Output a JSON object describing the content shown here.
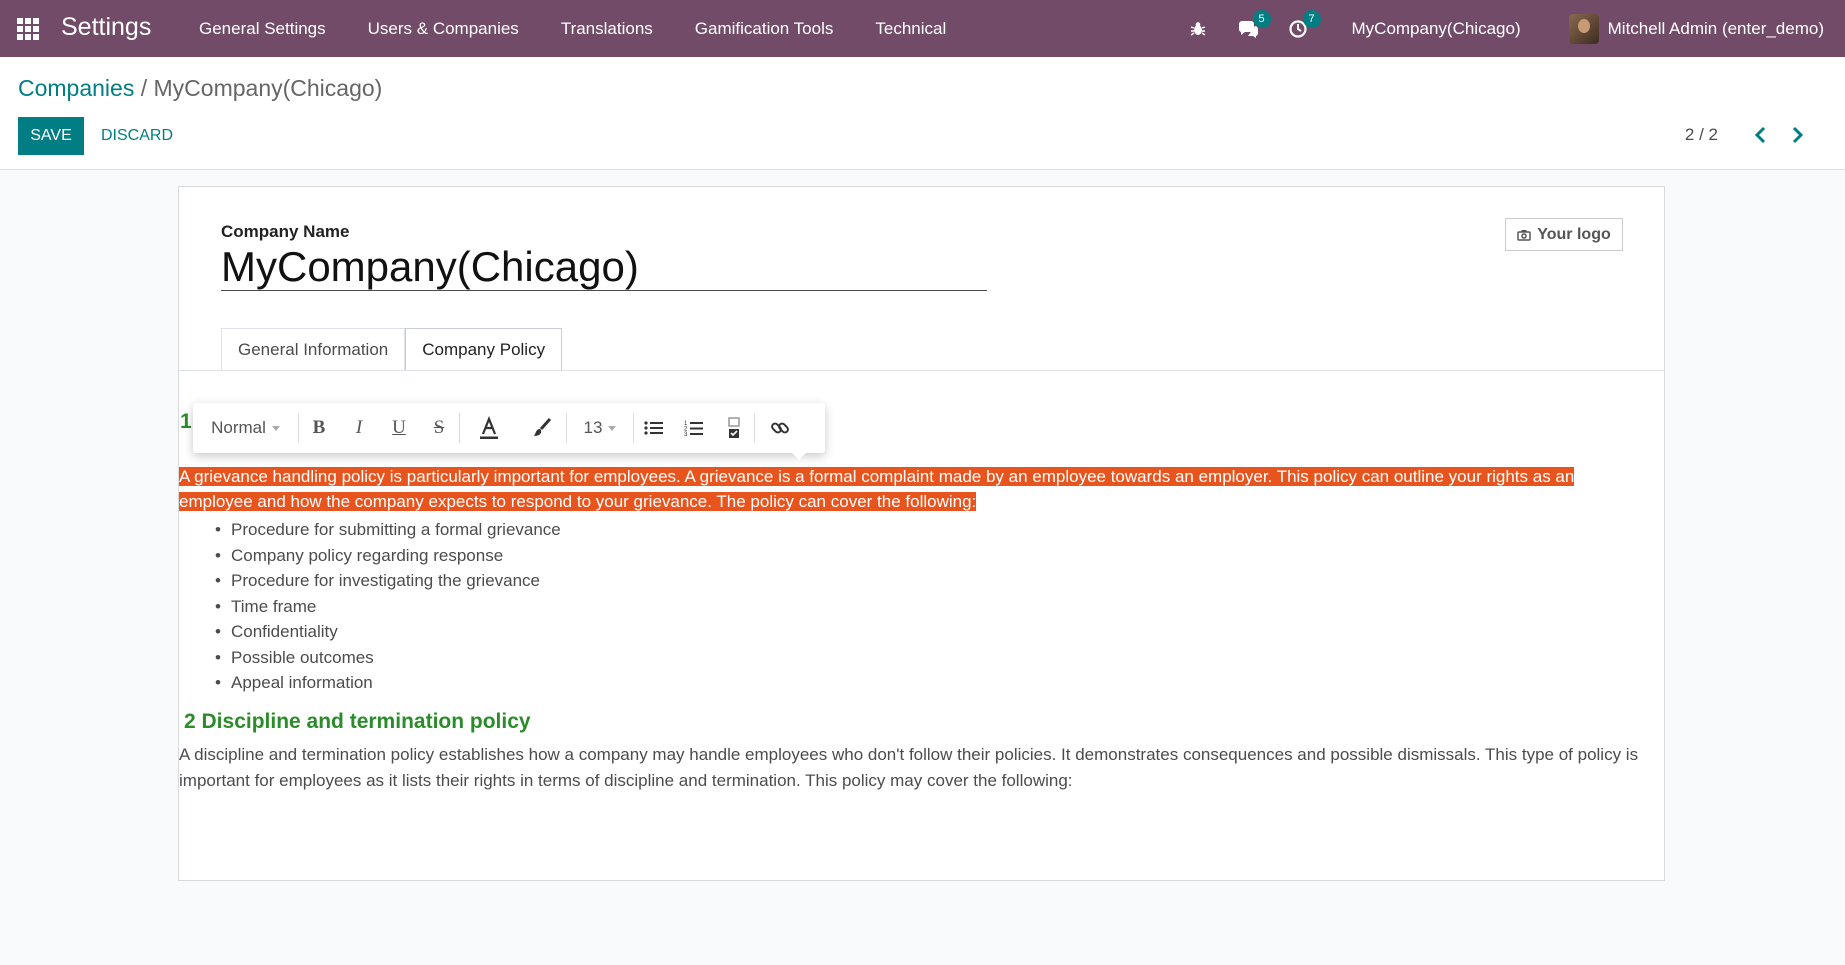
{
  "navbar": {
    "app_title": "Settings",
    "menu": [
      "General Settings",
      "Users & Companies",
      "Translations",
      "Gamification Tools",
      "Technical"
    ],
    "messages_badge": "5",
    "activities_badge": "7",
    "company": "MyCompany(Chicago)",
    "user": "Mitchell Admin (enter_demo)"
  },
  "breadcrumb": {
    "parent": "Companies",
    "separator": "/",
    "current": "MyCompany(Chicago)"
  },
  "actions": {
    "save": "SAVE",
    "discard": "DISCARD"
  },
  "pager": {
    "value": "2 / 2"
  },
  "form": {
    "name_label": "Company Name",
    "name_value": "MyCompany(Chicago)",
    "logo_button": "Your logo",
    "tabs": [
      "General Information",
      "Company Policy"
    ],
    "active_tab": "Company Policy"
  },
  "toolbar": {
    "style": "Normal",
    "font_size": "13"
  },
  "policy": {
    "heading1_number": "1",
    "grievance_paragraph": "A grievance handling policy is particularly important for employees. A grievance is a formal complaint made by an employee towards an employer. This policy can outline your rights as an employee and how the company expects to respond to your grievance. The policy can cover the following:",
    "grievance_items": [
      "Procedure for submitting a formal grievance",
      "Company policy regarding response",
      "Procedure for investigating the grievance",
      "Time frame",
      "Confidentiality",
      "Possible outcomes",
      "Appeal information"
    ],
    "heading2": "2 Discipline and termination policy",
    "discipline_paragraph": "A discipline and termination policy establishes how a company may handle employees who don't follow their policies. It demonstrates consequences and possible dismissals. This type of policy is important for employees as it lists their rights in terms of discipline and termination. This policy may cover the following:"
  },
  "colors": {
    "navbar": "#714b67",
    "accent": "#017e84",
    "selection": "#e8541e",
    "heading": "#2a8c2a"
  }
}
